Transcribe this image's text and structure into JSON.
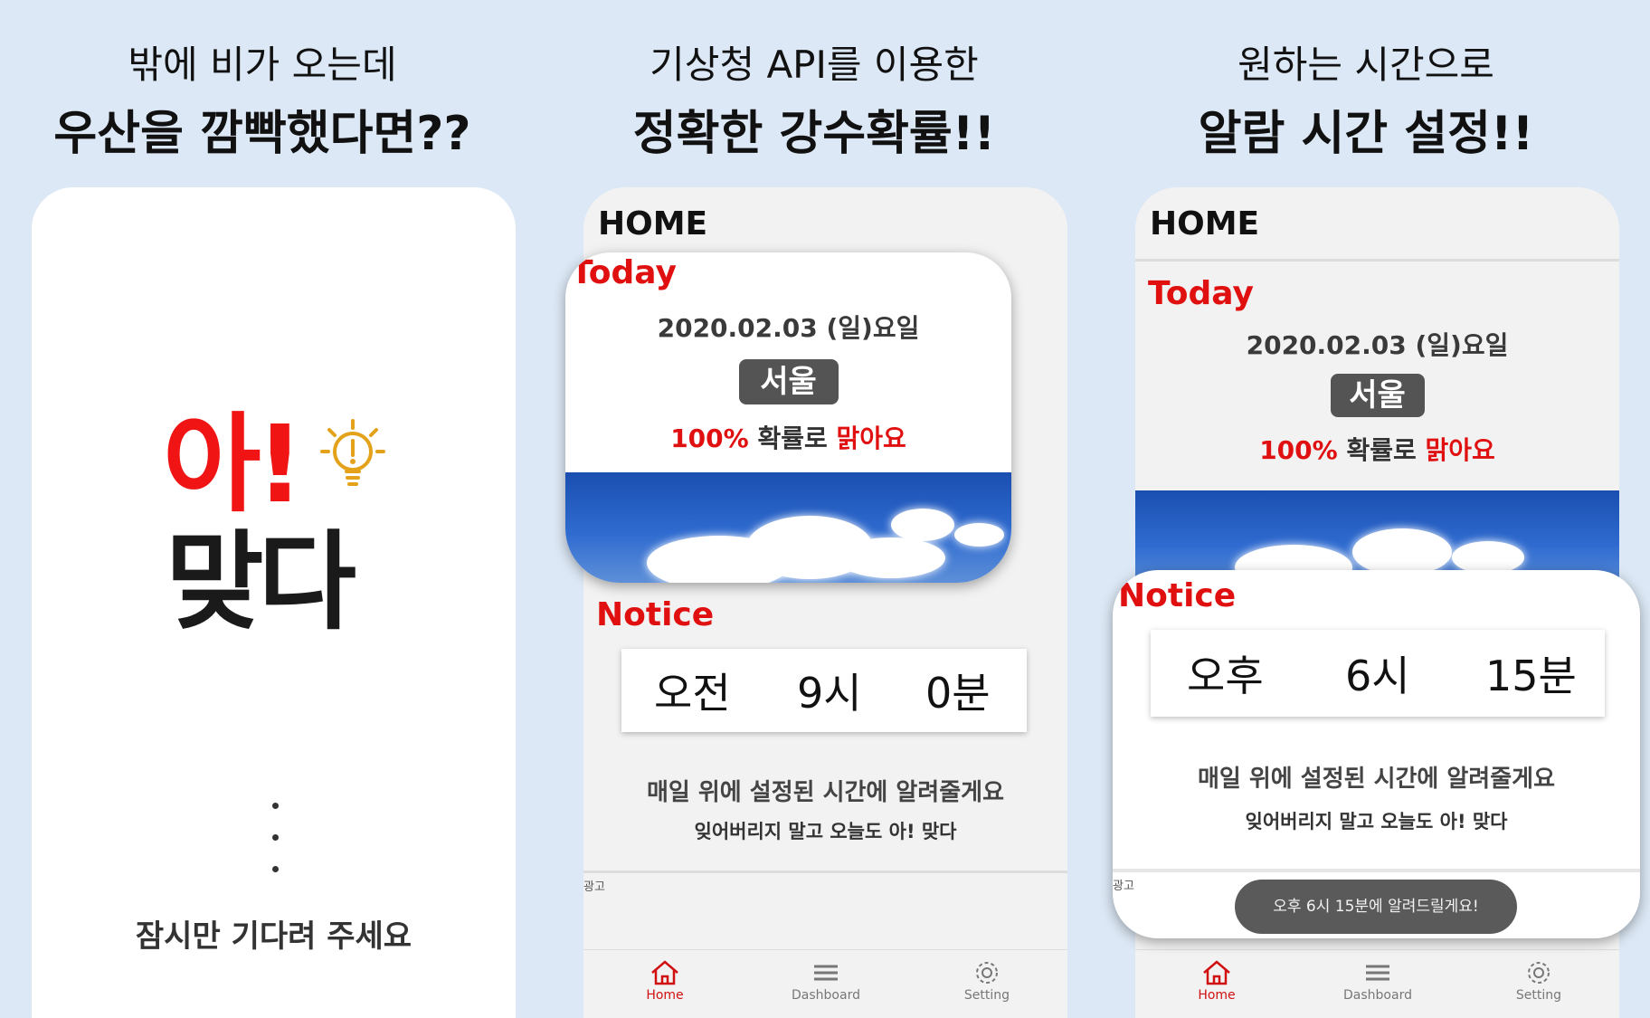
{
  "panels": [
    {
      "caption_sub": "밖에 비가 오는데",
      "caption_main": "우산을 깜빡했다면??",
      "splash": {
        "logo_top": "아!",
        "logo_bottom": "맞다",
        "wait_text": "잠시만 기다려 주세요"
      }
    },
    {
      "caption_sub": "기상청 API를 이용한",
      "caption_main": "정확한 강수확률!!"
    },
    {
      "caption_sub": "원하는 시간으로",
      "caption_main": "알람 시간 설정!!"
    }
  ],
  "screens": [
    {
      "home_title": "HOME",
      "today_label": "Today",
      "date": "2020.02.03 (일)요일",
      "city": "서울",
      "rain_percent": "100%",
      "rain_mid": " 확률로 ",
      "rain_status": "맑아요",
      "notice_label": "Notice",
      "time": {
        "ampm": "오전",
        "hour": "9시",
        "minute": "0분"
      },
      "message_1": "매일 위에 설정된 시간에 알려줄게요",
      "message_2": "잊어버리지 말고 오늘도 아! 맞다",
      "ad_label": "광고"
    },
    {
      "home_title": "HOME",
      "today_label": "Today",
      "date": "2020.02.03 (일)요일",
      "city": "서울",
      "rain_percent": "100%",
      "rain_mid": " 확률로 ",
      "rain_status": "맑아요",
      "notice_label": "Notice",
      "time": {
        "ampm": "오후",
        "hour": "6시",
        "minute": "15분"
      },
      "message_1": "매일 위에 설정된 시간에 알려줄게요",
      "message_2": "잊어버리지 말고 오늘도 아! 맞다",
      "ad_label": "광고",
      "toast": "오후 6시 15분에 알려드릴게요!"
    }
  ],
  "nav": {
    "home": "Home",
    "dashboard": "Dashboard",
    "setting": "Setting",
    "home_icon": "home-icon",
    "dashboard_icon": "menu-icon",
    "setting_icon": "gear-icon"
  },
  "colors": {
    "background": "#dce8f5",
    "accent_red": "#e01010",
    "badge_gray": "#545454",
    "sky_blue": "#2f6bd0"
  }
}
